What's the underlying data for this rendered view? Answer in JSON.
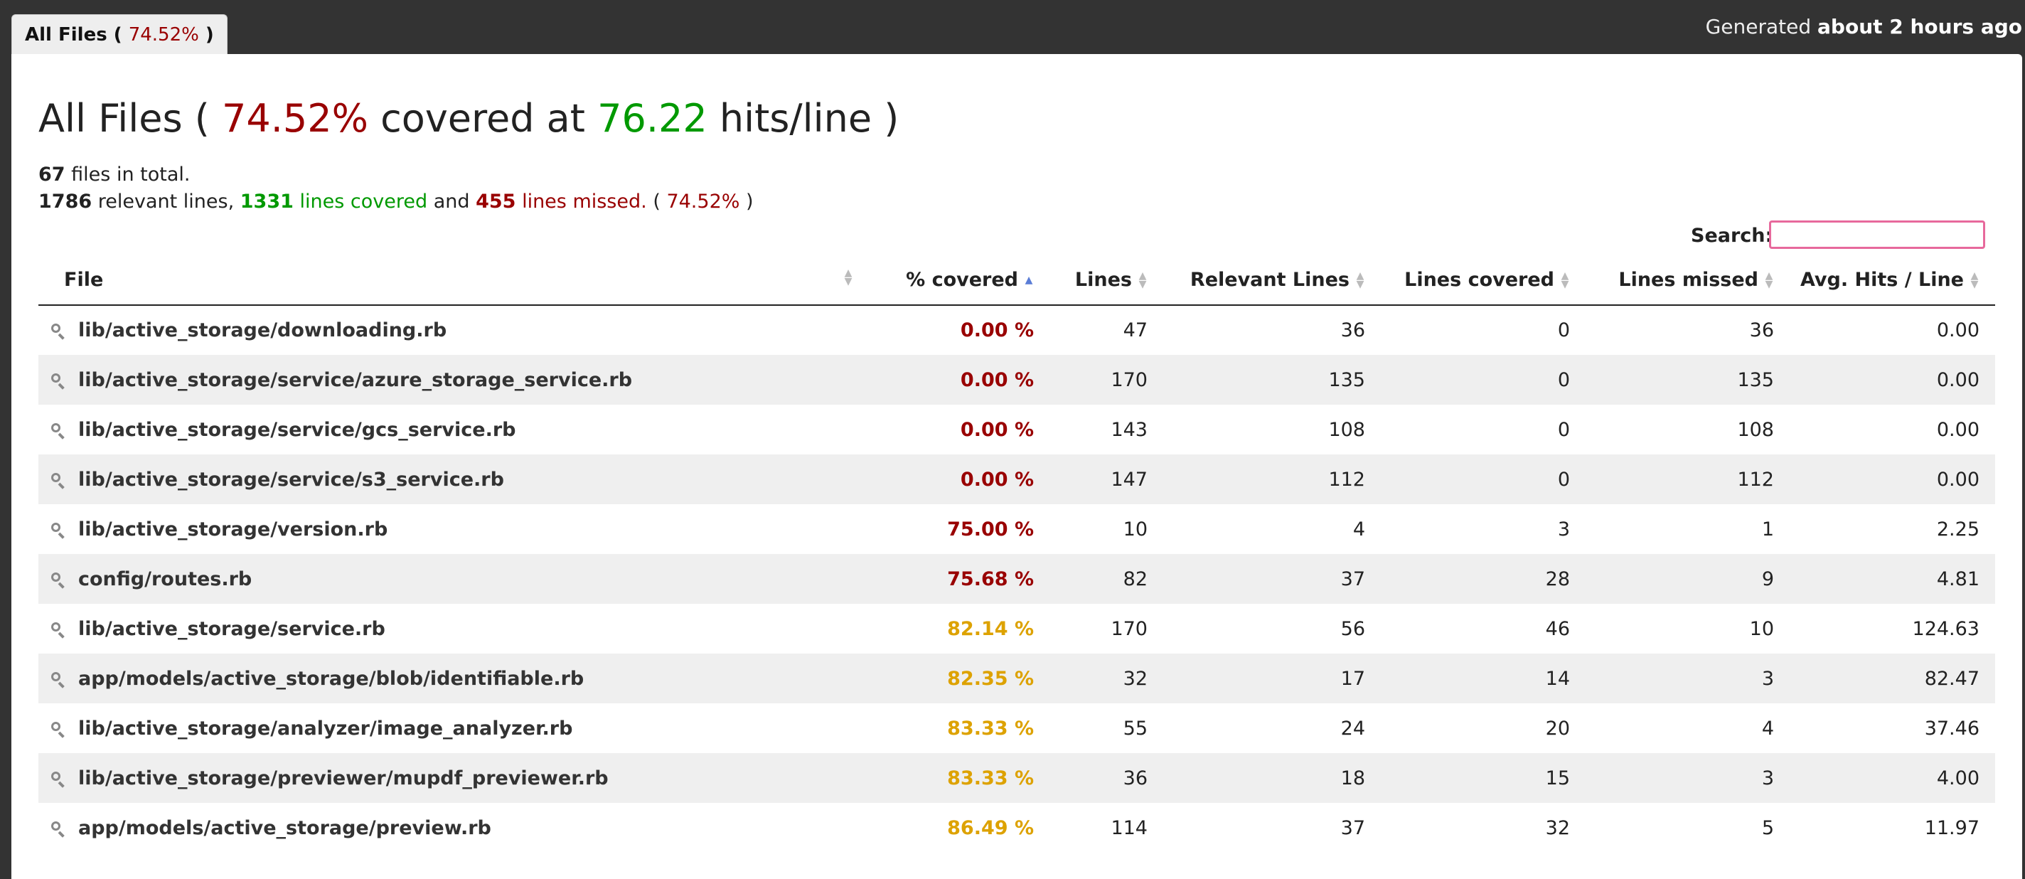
{
  "tab": {
    "label_prefix": "All Files (",
    "pct": "74.52%",
    "label_suffix": ")"
  },
  "generated": {
    "prefix": "Generated",
    "value": "about 2 hours ago"
  },
  "title": {
    "prefix": "All Files (",
    "pct": "74.52%",
    "mid": "covered at",
    "hits": "76.22",
    "suffix": "hits/line )"
  },
  "summary": {
    "files_count": "67",
    "files_text": "files in total.",
    "relevant": "1786",
    "relevant_text": "relevant lines,",
    "covered": "1331",
    "covered_text": "lines covered",
    "and": "and",
    "missed": "455",
    "missed_text": "lines missed.",
    "pct_open": "(",
    "pct": "74.52%",
    "pct_close": ")"
  },
  "search": {
    "label": "Search:",
    "value": ""
  },
  "columns": {
    "file": "File",
    "covered": "% covered",
    "lines": "Lines",
    "relevant": "Relevant Lines",
    "lines_covered": "Lines covered",
    "lines_missed": "Lines missed",
    "avg": "Avg. Hits / Line"
  },
  "colors": {
    "low": "#990000",
    "mid": "#DDA200",
    "high": "#009900"
  },
  "rows": [
    {
      "file": "lib/active_storage/downloading.rb",
      "covered": "0.00 %",
      "lines": "47",
      "relevant": "36",
      "lines_covered": "0",
      "lines_missed": "36",
      "avg": "0.00",
      "level": "low"
    },
    {
      "file": "lib/active_storage/service/azure_storage_service.rb",
      "covered": "0.00 %",
      "lines": "170",
      "relevant": "135",
      "lines_covered": "0",
      "lines_missed": "135",
      "avg": "0.00",
      "level": "low"
    },
    {
      "file": "lib/active_storage/service/gcs_service.rb",
      "covered": "0.00 %",
      "lines": "143",
      "relevant": "108",
      "lines_covered": "0",
      "lines_missed": "108",
      "avg": "0.00",
      "level": "low"
    },
    {
      "file": "lib/active_storage/service/s3_service.rb",
      "covered": "0.00 %",
      "lines": "147",
      "relevant": "112",
      "lines_covered": "0",
      "lines_missed": "112",
      "avg": "0.00",
      "level": "low"
    },
    {
      "file": "lib/active_storage/version.rb",
      "covered": "75.00 %",
      "lines": "10",
      "relevant": "4",
      "lines_covered": "3",
      "lines_missed": "1",
      "avg": "2.25",
      "level": "low"
    },
    {
      "file": "config/routes.rb",
      "covered": "75.68 %",
      "lines": "82",
      "relevant": "37",
      "lines_covered": "28",
      "lines_missed": "9",
      "avg": "4.81",
      "level": "low"
    },
    {
      "file": "lib/active_storage/service.rb",
      "covered": "82.14 %",
      "lines": "170",
      "relevant": "56",
      "lines_covered": "46",
      "lines_missed": "10",
      "avg": "124.63",
      "level": "mid"
    },
    {
      "file": "app/models/active_storage/blob/identifiable.rb",
      "covered": "82.35 %",
      "lines": "32",
      "relevant": "17",
      "lines_covered": "14",
      "lines_missed": "3",
      "avg": "82.47",
      "level": "mid"
    },
    {
      "file": "lib/active_storage/analyzer/image_analyzer.rb",
      "covered": "83.33 %",
      "lines": "55",
      "relevant": "24",
      "lines_covered": "20",
      "lines_missed": "4",
      "avg": "37.46",
      "level": "mid"
    },
    {
      "file": "lib/active_storage/previewer/mupdf_previewer.rb",
      "covered": "83.33 %",
      "lines": "36",
      "relevant": "18",
      "lines_covered": "15",
      "lines_missed": "3",
      "avg": "4.00",
      "level": "mid"
    },
    {
      "file": "app/models/active_storage/preview.rb",
      "covered": "86.49 %",
      "lines": "114",
      "relevant": "37",
      "lines_covered": "32",
      "lines_missed": "5",
      "avg": "11.97",
      "level": "mid"
    }
  ]
}
